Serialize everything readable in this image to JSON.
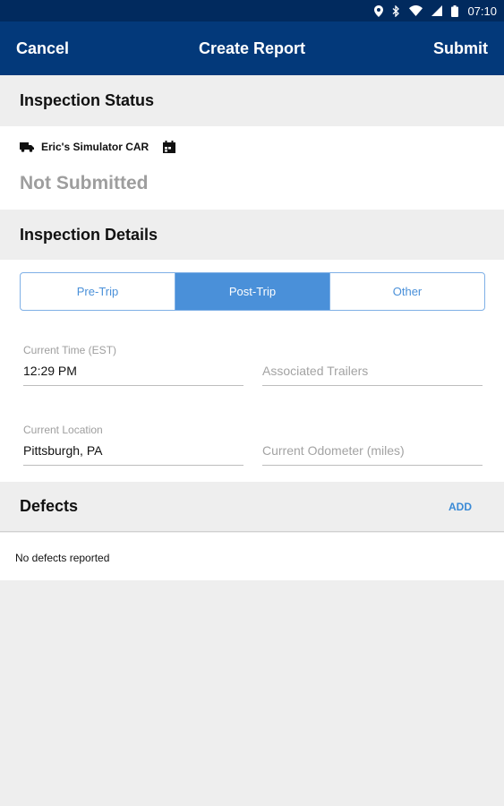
{
  "status_bar": {
    "time": "07:10"
  },
  "app_bar": {
    "cancel_label": "Cancel",
    "title": "Create Report",
    "submit_label": "Submit"
  },
  "inspection_status": {
    "header": "Inspection Status",
    "vehicle_name": "Eric's Simulator CAR",
    "status": "Not Submitted"
  },
  "inspection_details": {
    "header": "Inspection Details",
    "tabs": [
      {
        "label": "Pre-Trip",
        "active": false
      },
      {
        "label": "Post-Trip",
        "active": true
      },
      {
        "label": "Other",
        "active": false
      }
    ],
    "current_time": {
      "label": "Current Time (EST)",
      "value": "12:29 PM"
    },
    "associated_trailers": {
      "placeholder": "Associated Trailers"
    },
    "current_location": {
      "label": "Current Location",
      "value": "Pittsburgh, PA"
    },
    "current_odometer": {
      "placeholder": "Current Odometer (miles)"
    }
  },
  "defects": {
    "header": "Defects",
    "add_label": "ADD",
    "empty_text": "No defects reported"
  },
  "colors": {
    "status_bar": "#012a5e",
    "app_bar": "#03397a",
    "accent": "#4a90d9",
    "add": "#3a8ad6"
  },
  "icons": [
    "location-icon",
    "bluetooth-icon",
    "wifi-icon",
    "signal-icon",
    "battery-icon",
    "truck-icon",
    "calendar-icon"
  ]
}
